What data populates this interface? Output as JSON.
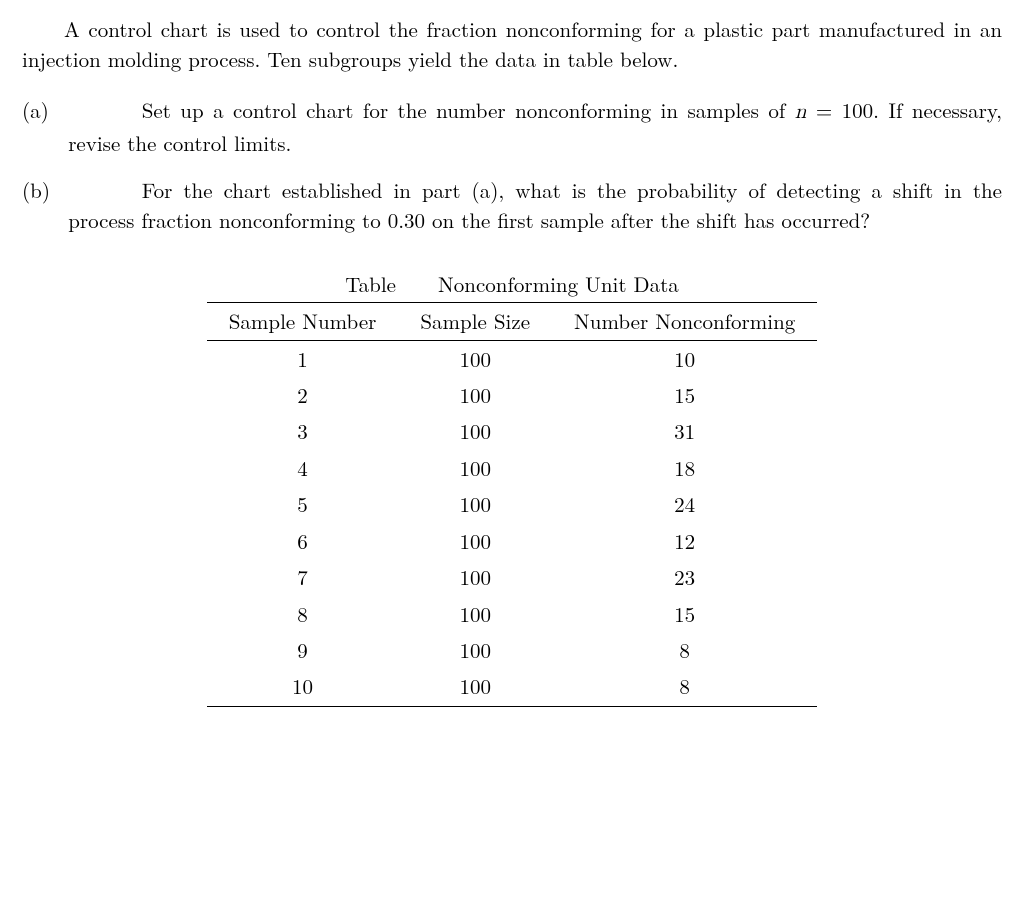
{
  "intro": "A control chart is used to control the fraction nonconforming for a plastic part manufactured in an injection molding process. Ten subgroups yield the data in table below.",
  "parts": {
    "a": {
      "label": "(a)",
      "text_before": "Set up a control chart for the number nonconforming in samples of ",
      "math_var": "n",
      "math_rest": " = 100. If necessary, revise the control limits."
    },
    "b": {
      "label": "(b)",
      "text": "For the chart established in part (a), what is the probability of detecting a shift in the process fraction nonconforming to 0.30 on the first sample after the shift has occurred?"
    }
  },
  "table": {
    "title_left": "Table",
    "title_right": "Nonconforming Unit Data",
    "headers": [
      "Sample Number",
      "Sample Size",
      "Number Nonconforming"
    ],
    "rows": [
      {
        "n": "1",
        "size": "100",
        "nc": "10"
      },
      {
        "n": "2",
        "size": "100",
        "nc": "15"
      },
      {
        "n": "3",
        "size": "100",
        "nc": "31"
      },
      {
        "n": "4",
        "size": "100",
        "nc": "18"
      },
      {
        "n": "5",
        "size": "100",
        "nc": "24"
      },
      {
        "n": "6",
        "size": "100",
        "nc": "12"
      },
      {
        "n": "7",
        "size": "100",
        "nc": "23"
      },
      {
        "n": "8",
        "size": "100",
        "nc": "15"
      },
      {
        "n": "9",
        "size": "100",
        "nc": "8"
      },
      {
        "n": "10",
        "size": "100",
        "nc": "8"
      }
    ]
  }
}
